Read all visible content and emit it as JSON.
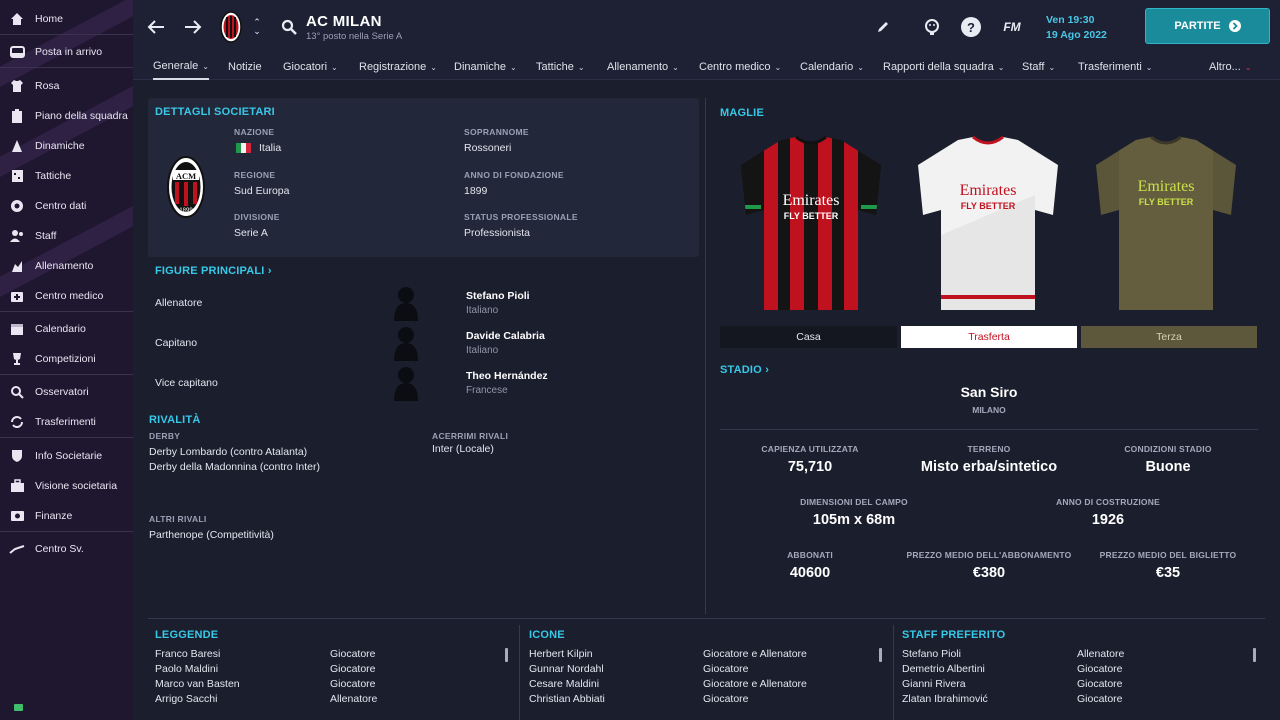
{
  "sidebar": {
    "items": [
      {
        "label": "Home",
        "icon": "home-icon"
      },
      {
        "label": "Posta in arrivo",
        "icon": "inbox-icon"
      },
      {
        "label": "Rosa",
        "icon": "shirt-icon"
      },
      {
        "label": "Piano della squadra",
        "icon": "clipboard-icon"
      },
      {
        "label": "Dinamiche",
        "icon": "dynamics-icon"
      },
      {
        "label": "Tattiche",
        "icon": "tactics-icon"
      },
      {
        "label": "Centro dati",
        "icon": "data-icon"
      },
      {
        "label": "Staff",
        "icon": "staff-icon"
      },
      {
        "label": "Allenamento",
        "icon": "training-icon"
      },
      {
        "label": "Centro medico",
        "icon": "medical-icon"
      },
      {
        "label": "Calendario",
        "icon": "calendar-icon"
      },
      {
        "label": "Competizioni",
        "icon": "trophy-icon"
      },
      {
        "label": "Osservatori",
        "icon": "scout-icon"
      },
      {
        "label": "Trasferimenti",
        "icon": "transfers-icon"
      },
      {
        "label": "Info Societarie",
        "icon": "shield-icon"
      },
      {
        "label": "Visione societaria",
        "icon": "briefcase-icon"
      },
      {
        "label": "Finanze",
        "icon": "finance-icon"
      },
      {
        "label": "Centro Sv.",
        "icon": "development-icon"
      }
    ]
  },
  "header": {
    "title": "AC MILAN",
    "subtitle": "13° posto nella Serie A",
    "date_line1": "Ven 19:30",
    "date_line2": "19 Ago 2022",
    "fm_label": "FM",
    "continue_label": "PARTITE"
  },
  "tabs": [
    {
      "label": "Generale",
      "chev": "⌄"
    },
    {
      "label": "Notizie",
      "chev": ""
    },
    {
      "label": "Giocatori",
      "chev": "⌄"
    },
    {
      "label": "Registrazione",
      "chev": "⌄"
    },
    {
      "label": "Dinamiche",
      "chev": "⌄"
    },
    {
      "label": "Tattiche",
      "chev": "⌄"
    },
    {
      "label": "Allenamento",
      "chev": "⌄"
    },
    {
      "label": "Centro medico",
      "chev": "⌄"
    },
    {
      "label": "Calendario",
      "chev": "⌄"
    },
    {
      "label": "Rapporti della squadra",
      "chev": "⌄"
    },
    {
      "label": "Staff",
      "chev": "⌄"
    },
    {
      "label": "Trasferimenti",
      "chev": "⌄"
    },
    {
      "label": "Altro...",
      "chev": "⌄"
    }
  ],
  "details": {
    "title": "DETTAGLI SOCIETARI",
    "nation_label": "NAZIONE",
    "nation_value": "Italia",
    "region_label": "REGIONE",
    "region_value": "Sud Europa",
    "division_label": "DIVISIONE",
    "division_value": "Serie A",
    "nickname_label": "SOPRANNOME",
    "nickname_value": "Rossoneri",
    "founded_label": "ANNO DI FONDAZIONE",
    "founded_value": "1899",
    "status_label": "STATUS PROFESSIONALE",
    "status_value": "Professionista",
    "badge_year": "1899",
    "badge_text": "ACM"
  },
  "figures": {
    "title": "FIGURE PRINCIPALI",
    "rows": [
      {
        "role": "Allenatore",
        "name": "Stefano Pioli",
        "nat": "Italiano"
      },
      {
        "role": "Capitano",
        "name": "Davide Calabria",
        "nat": "Italiano"
      },
      {
        "role": "Vice capitano",
        "name": "Theo Hernández",
        "nat": "Francese"
      }
    ]
  },
  "rivals": {
    "title": "RIVALITÀ",
    "derby_label": "DERBY",
    "derby_1": "Derby Lombardo (contro Atalanta)",
    "derby_2": "Derby della Madonnina (contro Inter)",
    "fierce_label": "ACERRIMI RIVALI",
    "fierce_1": "Inter (Locale)",
    "other_label": "ALTRI RIVALI",
    "other_1": "Parthenope (Competitività)"
  },
  "kits": {
    "title": "MAGLIE",
    "sponsor": "Emirates",
    "sponsor_sub": "FLY BETTER",
    "tabs": [
      "Casa",
      "Trasferta",
      "Terza"
    ],
    "selected": "Trasferta",
    "colors": {
      "home_red": "#c0111f",
      "home_black": "#141414",
      "away_white": "#f2f2f2",
      "third_olive": "#5b5639",
      "third_text": "#c9e04a"
    }
  },
  "stadium": {
    "title": "STADIO",
    "name": "San Siro",
    "city": "MILANO",
    "stats": [
      {
        "label": "CAPIENZA UTILIZZATA",
        "value": "75,710"
      },
      {
        "label": "TERRENO",
        "value": "Misto erba/sintetico"
      },
      {
        "label": "CONDIZIONI STADIO",
        "value": "Buone"
      },
      {
        "label": "DIMENSIONI DEL CAMPO",
        "value": "105m x 68m"
      },
      {
        "label": "ANNO DI COSTRUZIONE",
        "value": "1926"
      },
      {
        "label": "ABBONATI",
        "value": "40600"
      },
      {
        "label": "PREZZO MEDIO DELL'ABBONAMENTO",
        "value": "€380"
      },
      {
        "label": "PREZZO MEDIO DEL BIGLIETTO",
        "value": "€35"
      }
    ]
  },
  "legends": {
    "title": "LEGGENDE",
    "rows": [
      {
        "name": "Franco Baresi",
        "role": "Giocatore"
      },
      {
        "name": "Paolo Maldini",
        "role": "Giocatore"
      },
      {
        "name": "Marco van Basten",
        "role": "Giocatore"
      },
      {
        "name": "Arrigo Sacchi",
        "role": "Allenatore"
      }
    ]
  },
  "icons_list": {
    "title": "ICONE",
    "rows": [
      {
        "name": "Herbert Kilpin",
        "role": "Giocatore e Allenatore"
      },
      {
        "name": "Gunnar Nordahl",
        "role": "Giocatore"
      },
      {
        "name": "Cesare Maldini",
        "role": "Giocatore e Allenatore"
      },
      {
        "name": "Christian Abbiati",
        "role": "Giocatore"
      }
    ]
  },
  "favstaff": {
    "title": "STAFF PREFERITO",
    "rows": [
      {
        "name": "Stefano Pioli",
        "role": "Allenatore"
      },
      {
        "name": "Demetrio Albertini",
        "role": "Giocatore"
      },
      {
        "name": "Gianni Rivera",
        "role": "Giocatore"
      },
      {
        "name": "Zlatan Ibrahimović",
        "role": "Giocatore"
      }
    ]
  }
}
